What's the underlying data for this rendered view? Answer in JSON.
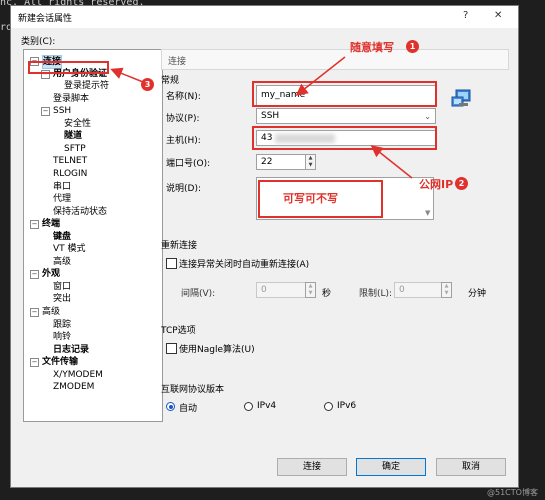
{
  "terminal": {
    "line1": "nc. All rights reserved.",
    "line2": "ro"
  },
  "window": {
    "title": "新建会话属性",
    "help_glyph": "?",
    "close_glyph": "✕"
  },
  "category": {
    "label": "类别(C):"
  },
  "tree": [
    {
      "label": "连接",
      "bold": true,
      "selected": true,
      "toggle": "−"
    },
    {
      "label": "用户身份验证",
      "bold": true,
      "toggle": "−"
    },
    {
      "label": "登录提示符"
    },
    {
      "label": "登录脚本"
    },
    {
      "label": "SSH",
      "toggle": "−"
    },
    {
      "label": "安全性"
    },
    {
      "label": "隧道",
      "bold": true
    },
    {
      "label": "SFTP"
    },
    {
      "label": "TELNET"
    },
    {
      "label": "RLOGIN"
    },
    {
      "label": "串口"
    },
    {
      "label": "代理"
    },
    {
      "label": "保持活动状态"
    },
    {
      "label": "终端",
      "bold": true,
      "toggle": "−"
    },
    {
      "label": "键盘",
      "bold": true
    },
    {
      "label": "VT 模式"
    },
    {
      "label": "高级"
    },
    {
      "label": "外观",
      "bold": true,
      "toggle": "−"
    },
    {
      "label": "窗口"
    },
    {
      "label": "突出"
    },
    {
      "label": "高级",
      "toggle": "−"
    },
    {
      "label": "跟踪"
    },
    {
      "label": "响铃"
    },
    {
      "label": "日志记录",
      "bold": true
    },
    {
      "label": "文件传输",
      "bold": true,
      "toggle": "−"
    },
    {
      "label": "X/YMODEM"
    },
    {
      "label": "ZMODEM"
    }
  ],
  "header": {
    "title": "连接"
  },
  "general": {
    "group_label": "常规",
    "name_label": "名称(N):",
    "name_value": "my_name",
    "protocol_label": "协议(P):",
    "protocol_value": "SSH",
    "host_label": "主机(H):",
    "host_value": "43",
    "port_label": "端口号(O):",
    "port_value": "22",
    "desc_label": "说明(D):",
    "desc_value": ""
  },
  "reconnect": {
    "group_label": "重新连接",
    "auto_label": "连接异常关闭时自动重新连接(A)",
    "interval_label": "间隔(V):",
    "interval_value": "0",
    "interval_unit": "秒",
    "limit_label": "限制(L):",
    "limit_value": "0",
    "limit_unit": "分钟"
  },
  "tcp": {
    "group_label": "TCP选项",
    "nagle_label": "使用Nagle算法(U)"
  },
  "ipver": {
    "group_label": "互联网协议版本",
    "options": [
      "自动",
      "IPv4",
      "IPv6"
    ],
    "selected": "自动"
  },
  "buttons": {
    "connect": "连接",
    "ok": "确定",
    "cancel": "取消"
  },
  "annotations": {
    "a1_text": "随意填写",
    "a1_num": "1",
    "a2_text": "公网IP",
    "a2_num": "2",
    "a3_num": "3",
    "box_text": "可写可不写"
  },
  "watermark": "@51CTO博客",
  "colors": {
    "annotation": "#e0322c",
    "accent": "#0078d7"
  }
}
